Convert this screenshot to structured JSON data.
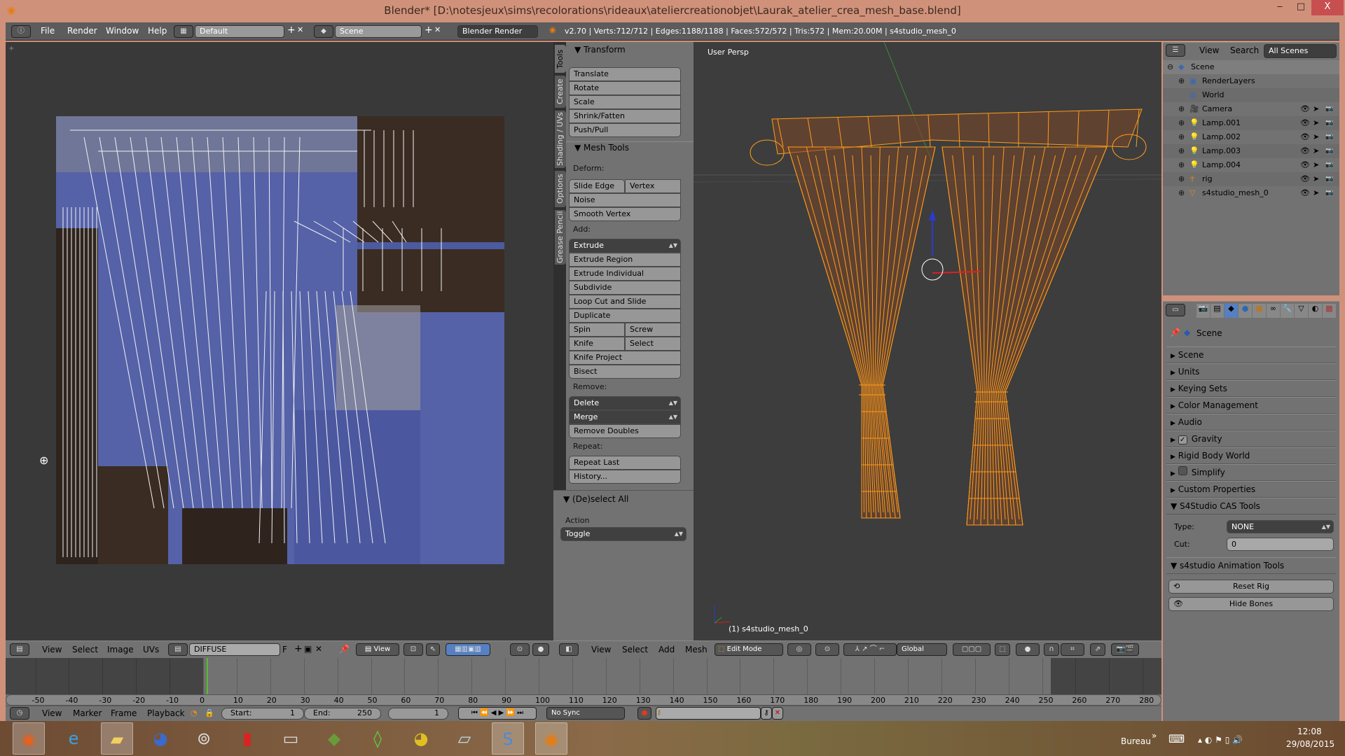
{
  "window": {
    "title": "Blender* [D:\\notesjeux\\sims\\recolorations\\rideaux\\ateliercreationobjet\\Laurak_atelier_crea_mesh_base.blend]",
    "minimize": "‒",
    "maximize": "□",
    "close": "X"
  },
  "info_header": {
    "menus": [
      "File",
      "Render",
      "Window",
      "Help"
    ],
    "layout": "Default",
    "scene": "Scene",
    "engine": "Blender Render",
    "stats": "v2.70 | Verts:712/712 | Edges:1188/1188 | Faces:572/572 | Tris:572 | Mem:20.00M | s4studio_mesh_0"
  },
  "tool_shelf": {
    "tabs": [
      "Tools",
      "Create",
      "Shading / UVs",
      "Options",
      "Grease Pencil"
    ],
    "active_tab": "Tools",
    "transform": {
      "title": "Transform",
      "buttons": [
        "Translate",
        "Rotate",
        "Scale",
        "Shrink/Fatten",
        "Push/Pull"
      ]
    },
    "mesh_tools": {
      "title": "Mesh Tools",
      "deform_label": "Deform:",
      "deform": [
        "Slide Edge",
        "Vertex",
        "Noise",
        "Smooth Vertex"
      ],
      "add_label": "Add:",
      "add": [
        "Extrude",
        "Extrude Region",
        "Extrude Individual",
        "Subdivide",
        "Loop Cut and Slide",
        "Duplicate",
        "Spin",
        "Screw",
        "Knife",
        "Select",
        "Knife Project",
        "Bisect"
      ],
      "remove_label": "Remove:",
      "remove": [
        "Delete",
        "Merge",
        "Remove Doubles"
      ],
      "repeat_label": "Repeat:",
      "repeat": [
        "Repeat Last",
        "History..."
      ]
    },
    "redo": {
      "title": "(De)select All",
      "action_label": "Action",
      "action_value": "Toggle"
    }
  },
  "viewport": {
    "view_name": "User Persp",
    "object_label": "(1) s4studio_mesh_0",
    "wire_color": "#ff9c1a"
  },
  "outliner": {
    "view": "View",
    "search": "Search",
    "filter": "All Scenes",
    "items": [
      {
        "name": "Scene",
        "icon": "scene-icon"
      },
      {
        "name": "RenderLayers",
        "icon": "render-layers-icon"
      },
      {
        "name": "World",
        "icon": "world-icon"
      },
      {
        "name": "Camera",
        "icon": "camera-icon"
      },
      {
        "name": "Lamp.001",
        "icon": "lamp-icon"
      },
      {
        "name": "Lamp.002",
        "icon": "lamp-icon"
      },
      {
        "name": "Lamp.003",
        "icon": "lamp-icon"
      },
      {
        "name": "Lamp.004",
        "icon": "lamp-icon"
      },
      {
        "name": "rig",
        "icon": "armature-icon"
      },
      {
        "name": "s4studio_mesh_0",
        "icon": "mesh-icon"
      }
    ]
  },
  "properties": {
    "context": "Scene",
    "panels": [
      "Scene",
      "Units",
      "Keying Sets",
      "Color Management",
      "Audio",
      "Gravity",
      "Rigid Body World",
      "Simplify",
      "Custom Properties"
    ],
    "gravity_checked": true,
    "simplify_checked": false,
    "cas_tools": {
      "title": "S4Studio CAS Tools",
      "type_label": "Type:",
      "type_value": "NONE",
      "cut_label": "Cut:",
      "cut_value": "0"
    },
    "anim_tools": {
      "title": "s4studio Animation Tools",
      "reset_rig": "Reset Rig",
      "hide_bones": "Hide Bones"
    }
  },
  "uv_header": {
    "menus": [
      "View",
      "Select",
      "Image",
      "UVs"
    ],
    "image": "DIFFUSE",
    "fake_user": "F",
    "view": "View"
  },
  "view3d_header": {
    "menus": [
      "View",
      "Select",
      "Add",
      "Mesh"
    ],
    "mode": "Edit Mode",
    "orientation": "Global"
  },
  "timeline": {
    "ticks": [
      "-50",
      "-40",
      "-30",
      "-20",
      "-10",
      "0",
      "10",
      "20",
      "30",
      "40",
      "50",
      "60",
      "70",
      "80",
      "90",
      "100",
      "110",
      "120",
      "130",
      "140",
      "150",
      "160",
      "170",
      "180",
      "190",
      "200",
      "210",
      "220",
      "230",
      "240",
      "250",
      "260",
      "270",
      "280"
    ],
    "menus": [
      "View",
      "Marker",
      "Frame",
      "Playback"
    ],
    "start_label": "Start:",
    "start": "1",
    "end_label": "End:",
    "end": "250",
    "current": "1",
    "sync": "No Sync"
  },
  "taskbar": {
    "apps": [
      "Firefox",
      "Internet Explorer",
      "File Explorer",
      "Thunderbird",
      "App",
      "App",
      "App",
      "Minecraft",
      "The Sims 4",
      "Chrome",
      "App",
      "S4Studio",
      "Blender"
    ],
    "toolbar": "Bureau",
    "time": "12:08",
    "date": "29/08/2015"
  }
}
